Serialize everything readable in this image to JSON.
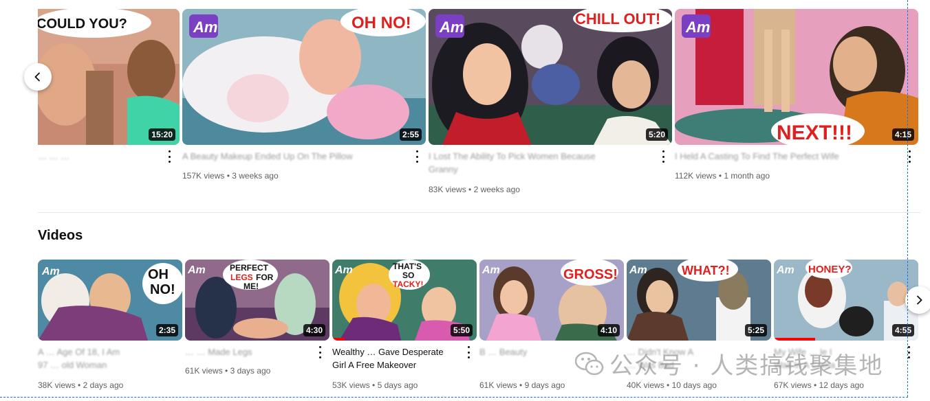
{
  "shorts_row": {
    "cards": [
      {
        "duration": "15:20",
        "title": "… … …",
        "views": "",
        "age": "",
        "title_blur": true
      },
      {
        "duration": "2:55",
        "title": "A Beauty Makeup Ended Up On The Pillow",
        "views": "157K views",
        "age": "3 weeks ago",
        "title_blur": true
      },
      {
        "duration": "5:20",
        "title": "I Lost The Ability To Pick Women Because",
        "title2": "Granny",
        "views": "83K views",
        "age": "2 weeks ago",
        "title_blur": true
      },
      {
        "duration": "4:15",
        "title": "I Held A Casting To Find The Perfect Wife",
        "views": "112K views",
        "age": "1 month ago",
        "title_blur": true
      }
    ],
    "thumb_text": [
      "COULD YOU?",
      "OH NO!",
      "CHILL OUT!",
      "NEXT!!!"
    ]
  },
  "videos_section": {
    "title": "Videos",
    "cards": [
      {
        "duration": "2:35",
        "title": "A … Age Of 18, I Am",
        "title2": "97 … old Woman",
        "views": "38K views",
        "age": "2 days ago",
        "thumb_text": "OH NO!"
      },
      {
        "duration": "4:30",
        "title": "… … Made Legs",
        "title2": "",
        "views": "61K views",
        "age": "3 days ago",
        "thumb_text": "PERFECT LEGS FOR ME!"
      },
      {
        "duration": "5:50",
        "title": "Wealthy … Gave Desperate",
        "title2": "Girl A Free Makeover",
        "views": "53K views",
        "age": "5 days ago",
        "thumb_text": "THAT'S SO TACKY!"
      },
      {
        "duration": "4:10",
        "title": "B … Beauty",
        "title2": "",
        "views": "61K views",
        "age": "9 days ago",
        "thumb_text": "GROSS!"
      },
      {
        "duration": "5:25",
        "title": "… Didn't Know A",
        "title2": "… Was Bad",
        "views": "40K views",
        "age": "10 days ago",
        "thumb_text": "WHAT?!"
      },
      {
        "duration": "4:55",
        "title": "My Wife … le I",
        "title2": "Was In A Coma",
        "views": "67K views",
        "age": "12 days ago",
        "thumb_text": "HONEY?"
      }
    ]
  },
  "watermark_text": "公众号 · 人类搞钱聚集地",
  "icons": {
    "prev": "chevron-left-icon",
    "next": "chevron-right-icon",
    "more": "more-vert-icon",
    "logo": "am-logo"
  },
  "colors": {
    "accent": "#ff0000",
    "dash": "#1a73e8"
  }
}
